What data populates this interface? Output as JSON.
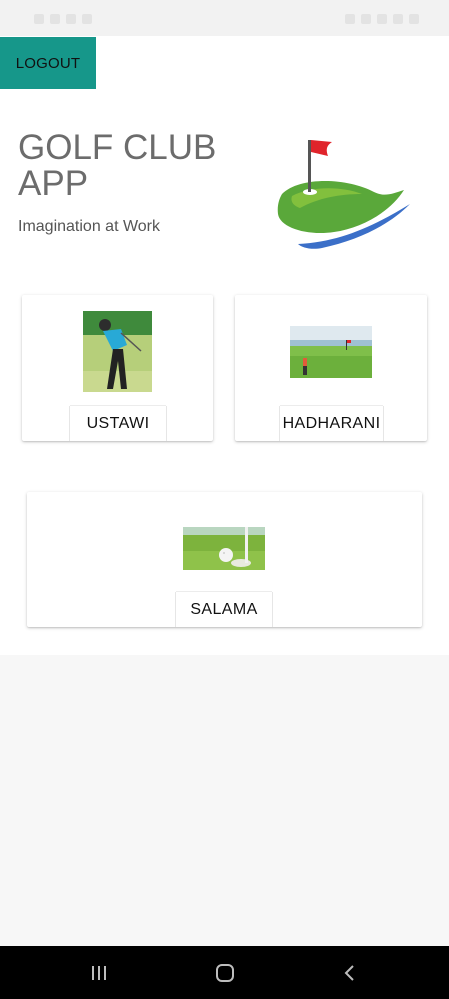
{
  "logout": {
    "label": "LOGOUT"
  },
  "header": {
    "title": "GOLF CLUB APP",
    "subtitle": "Imagination at Work",
    "logo_icon": "golf-flag-logo-icon"
  },
  "clubs": [
    {
      "label": "USTAWI",
      "image": "golfer-swing-photo"
    },
    {
      "label": "HADHARANI",
      "image": "golf-course-photo"
    },
    {
      "label": "SALAMA",
      "image": "golf-ball-hole-photo"
    }
  ],
  "nav": {
    "recents_icon": "recent-apps-icon",
    "home_icon": "home-icon",
    "back_icon": "back-icon"
  },
  "colors": {
    "accent": "#16978a",
    "logo_green": "#5aa83a",
    "logo_blue": "#3b6fc8",
    "flag_red": "#e0242b"
  }
}
